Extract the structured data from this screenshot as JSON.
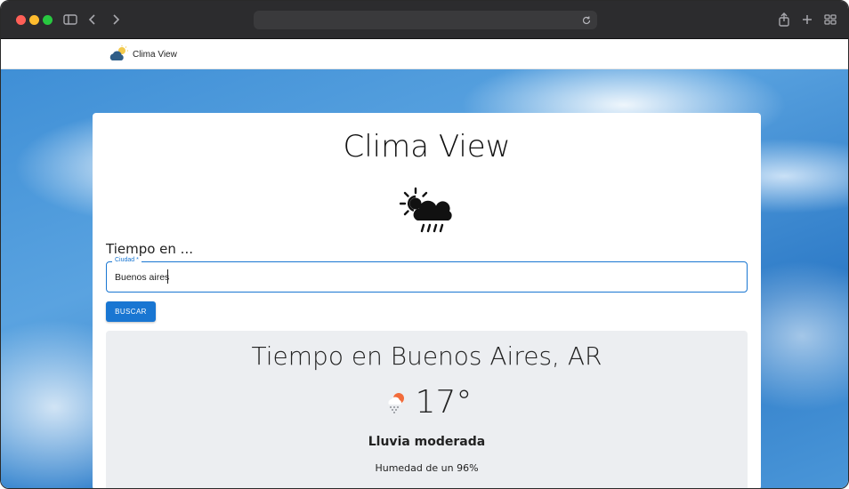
{
  "browser": {
    "url": "",
    "icons": [
      "sidebar-icon",
      "back-icon",
      "forward-icon",
      "reload-icon",
      "share-icon",
      "new-tab-icon",
      "tab-overview-icon"
    ]
  },
  "navbar": {
    "brand": "Clima View"
  },
  "card": {
    "title": "Clima View",
    "section_label": "Tiempo en ...",
    "city_field": {
      "legend": "Ciudad *",
      "value": "Buenos aires",
      "placeholder": ""
    },
    "search_button": "BUSCAR"
  },
  "result": {
    "title": "Tiempo en Buenos Aires, AR",
    "temperature": "17°",
    "condition": "Lluvia moderada",
    "humidity": "Humedad de un 96%"
  },
  "colors": {
    "primary": "#1976d2",
    "result_bg": "#eceef1",
    "toolbar": "#2c2c2e"
  }
}
